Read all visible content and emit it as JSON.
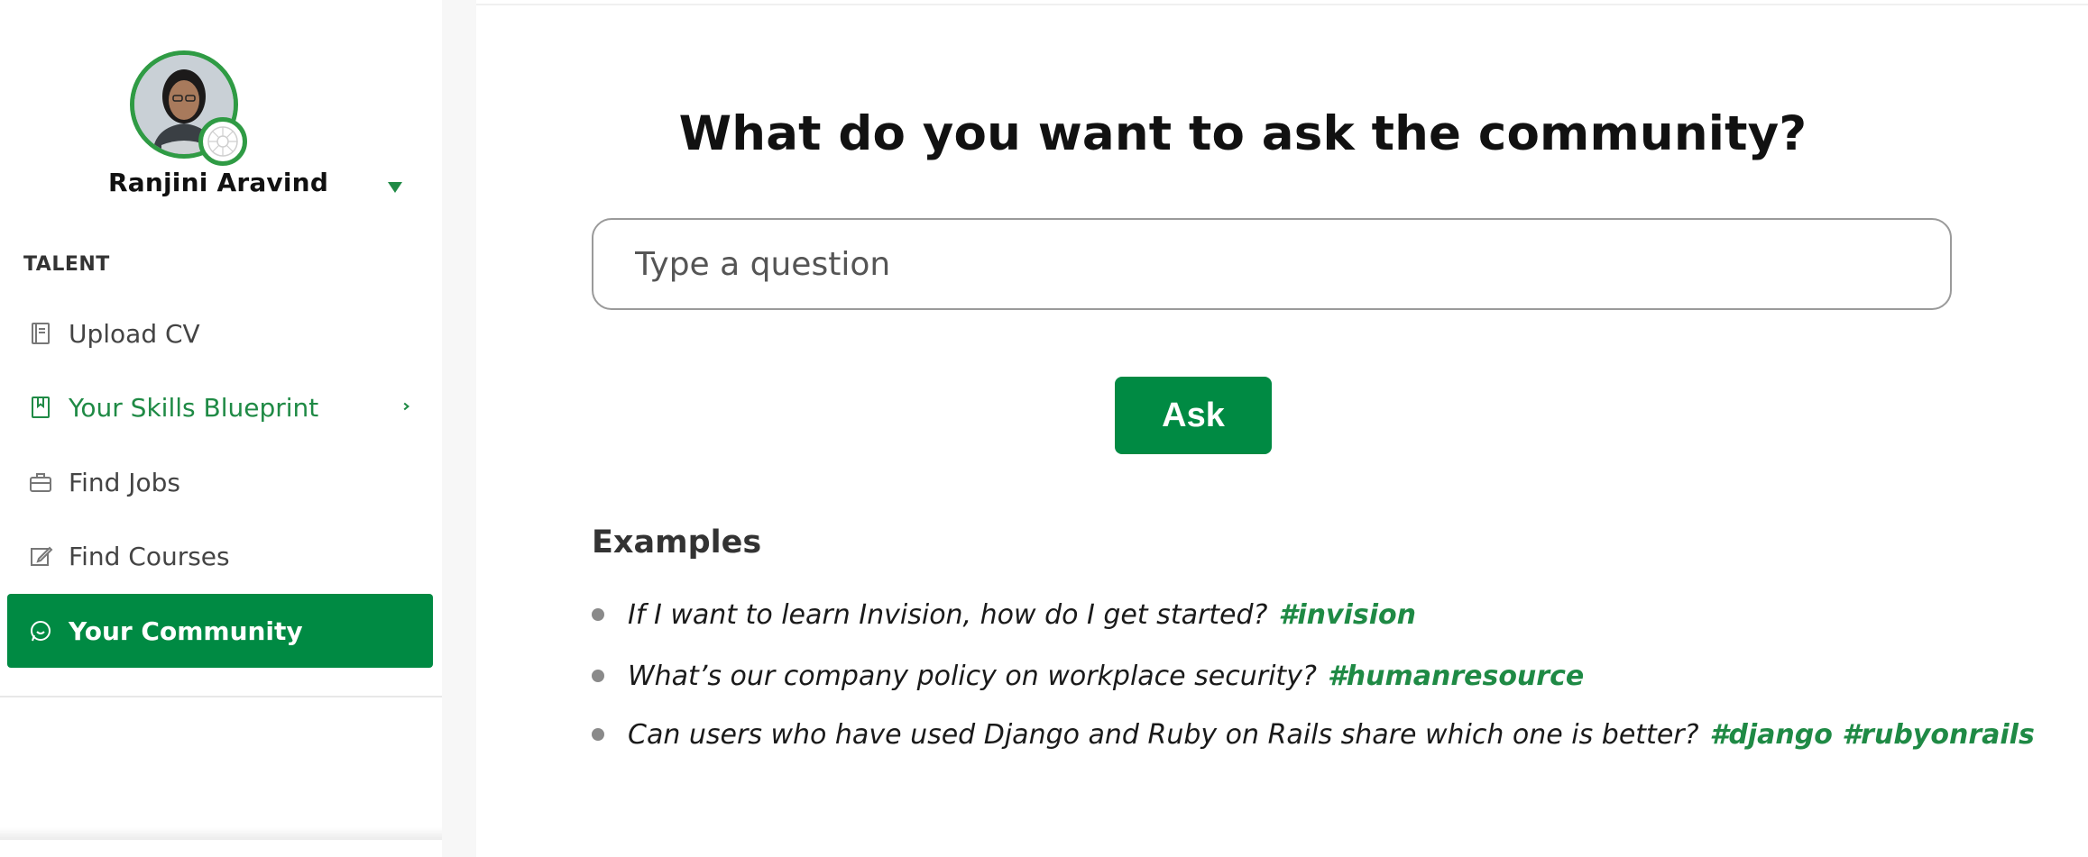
{
  "user": {
    "name": "Ranjini Aravind"
  },
  "sidebar": {
    "section_label": "TALENT",
    "items": [
      {
        "label": "Upload CV",
        "icon": "document-icon",
        "state": "default"
      },
      {
        "label": "Your Skills Blueprint",
        "icon": "bookmark-icon",
        "state": "highlighted"
      },
      {
        "label": "Find Jobs",
        "icon": "briefcase-icon",
        "state": "default"
      },
      {
        "label": "Find Courses",
        "icon": "edit-icon",
        "state": "default"
      },
      {
        "label": "Your Community",
        "icon": "chat-icon",
        "state": "active"
      }
    ]
  },
  "main": {
    "headline": "What do you want to ask the community?",
    "question_placeholder": "Type a question",
    "ask_label": "Ask",
    "examples_title": "Examples",
    "examples": [
      {
        "text": "If I want to learn Invision, how do I get started?",
        "tags": "#invision"
      },
      {
        "text": "What’s our company policy on workplace security?",
        "tags": "#humanresource"
      },
      {
        "text": "Can users who have used Django and Ruby on Rails share which one is better?",
        "tags": "#django #rubyonrails"
      }
    ]
  },
  "colors": {
    "accent": "#008a43",
    "accent_text": "#1f8a45",
    "avatar_ring": "#2f9b44"
  }
}
